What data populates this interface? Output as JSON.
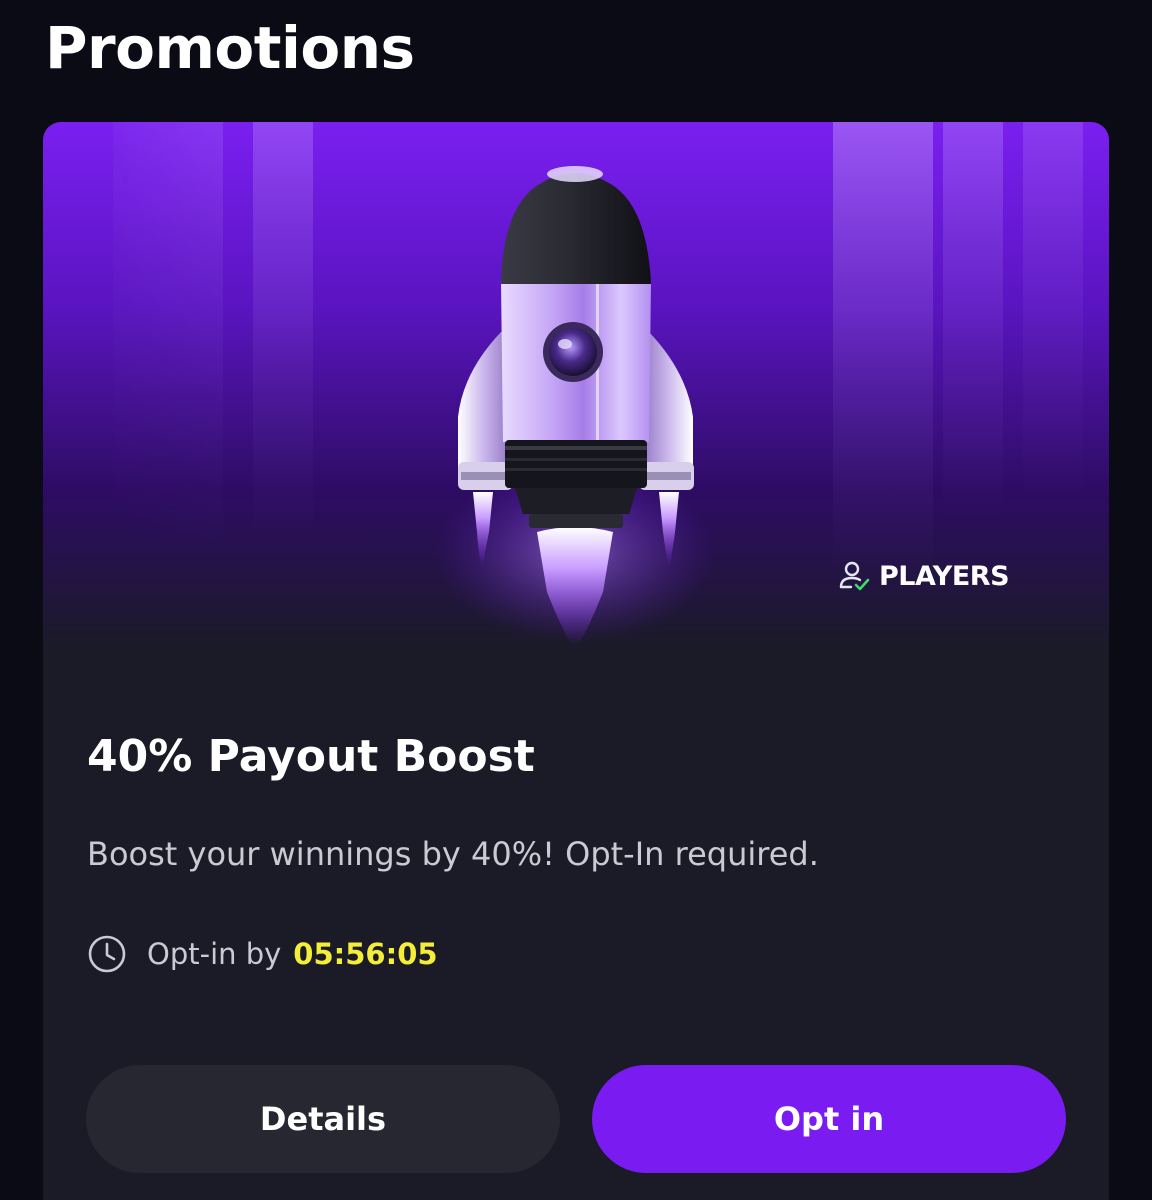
{
  "page": {
    "title": "Promotions"
  },
  "promo": {
    "brand": "PLAYERS",
    "brand_icon": "user-check-icon",
    "illustration": "rocket",
    "title": "40% Payout Boost",
    "description": "Boost your winnings by 40%! Opt-In required.",
    "deadline_label": "Opt-in by",
    "deadline_timer": "05:56:05",
    "deadline_icon": "clock-icon",
    "details_label": "Details",
    "optin_label": "Opt in"
  },
  "colors": {
    "background": "#0a0b14",
    "card": "#1a1b26",
    "accent": "#7a1bf2",
    "timer": "#f4ee3a",
    "secondary_button": "#262730",
    "muted_text": "#c9cad3"
  }
}
